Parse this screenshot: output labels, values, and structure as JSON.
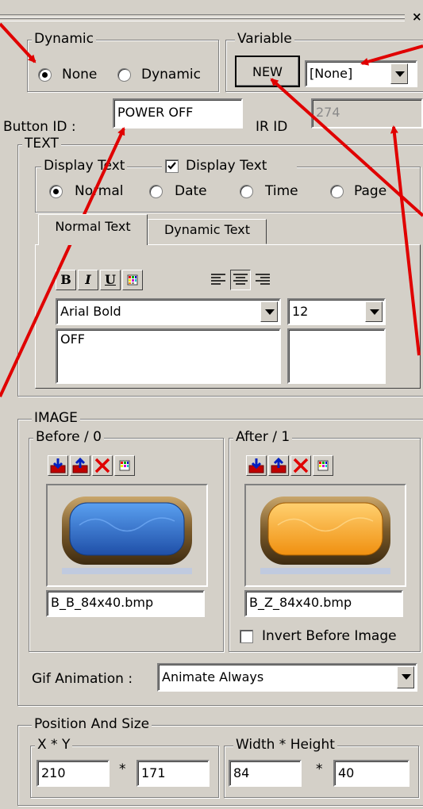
{
  "dynamic": {
    "legend": "Dynamic",
    "options": [
      "None",
      "Dynamic"
    ],
    "selected": "None"
  },
  "variable": {
    "legend": "Variable",
    "new_label": "NEW",
    "selected": "[None]"
  },
  "button_id": {
    "label": "Button ID :",
    "value": "POWER OFF"
  },
  "ir_id": {
    "label": "IR ID",
    "value": "274"
  },
  "text": {
    "legend": "TEXT",
    "display_text_legend": "Display Text",
    "display_text_check_label": "Display Text",
    "display_text_checked": true,
    "modes": [
      "Normal",
      "Date",
      "Time",
      "Page"
    ],
    "selected_mode": "Normal",
    "tabs": [
      "Normal Text",
      "Dynamic Text"
    ],
    "active_tab": "Normal Text",
    "format_buttons": [
      "B",
      "I",
      "U"
    ],
    "font": "Arial Bold",
    "size": "12",
    "content": "OFF"
  },
  "image": {
    "legend": "IMAGE",
    "before_legend": "Before / 0",
    "after_legend": "After / 1",
    "before_file": "B_B_84x40.bmp",
    "after_file": "B_Z_84x40.bmp",
    "invert_label": "Invert Before Image",
    "before_color": "#2f6fcf",
    "after_color": "#f6a21e"
  },
  "gif": {
    "label": "Gif Animation :",
    "value": "Animate Always"
  },
  "position": {
    "legend": "Position And Size",
    "xy_legend": "X * Y",
    "wh_legend": "Width * Height",
    "x": "210",
    "y": "171",
    "width": "84",
    "height": "40",
    "separator": "*"
  },
  "colors": {
    "annotation_arrow": "#e00000",
    "panel_bg": "#d4d0c8"
  }
}
